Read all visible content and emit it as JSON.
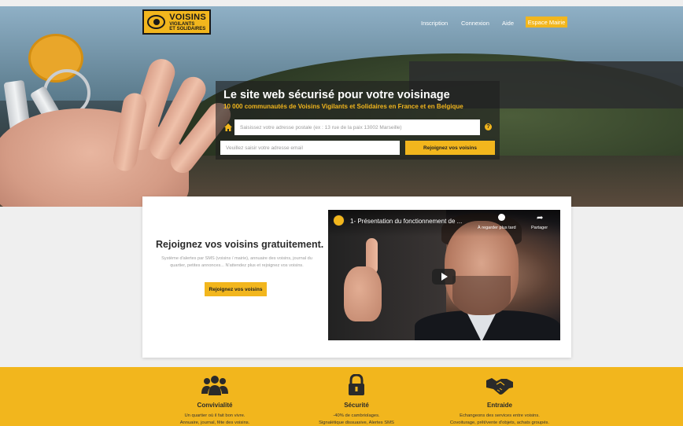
{
  "nav": {
    "logo_line1": "VOISINS",
    "logo_line2": "VIGILANTS",
    "logo_line3": "ET SOLIDAIRES",
    "inscription": "Inscription",
    "connexion": "Connexion",
    "aide": "Aide",
    "espace_mairie": "Espace Mairie"
  },
  "hero": {
    "title": "Le site web sécurisé pour votre voisinage",
    "subtitle": "10 000 communautés de Voisins Vigilants et Solidaires en France et en Belgique",
    "address_placeholder": "Saisissez votre adresse postale (ex : 13 rue de la paix 13002 Marseille)",
    "email_placeholder": "Veuillez saisir votre adresse email",
    "join_button": "Rejoignez vos voisins",
    "help_glyph": "?"
  },
  "card": {
    "title": "Rejoignez vos voisins gratuitement.",
    "description": "Système d'alertes par SMS (voisins / mairie), annuaire des voisins, journal du quartier, petites annonces... N'attendez plus et rejoignez vos voisins.",
    "button": "Rejoignez vos voisins"
  },
  "video": {
    "title": "1- Présentation du fonctionnement de ...",
    "watch_later": "À regarder plus tard",
    "share": "Partager"
  },
  "features": [
    {
      "icon": "users-icon",
      "title": "Convivialité",
      "line1": "Un quartier où il fait bon vivre.",
      "line2": "Annuaire, journal, fête des voisins."
    },
    {
      "icon": "lock-icon",
      "title": "Sécurité",
      "line1": "-40% de cambriolages.",
      "line2": "Signalétique dissuasive, Alertes SMS"
    },
    {
      "icon": "handshake-icon",
      "title": "Entraide",
      "line1": "Echangeons des services entre voisins.",
      "line2": "Covoiturage, prêt/vente d'objets, achats groupés."
    }
  ],
  "colors": {
    "accent": "#f2b61d",
    "dark": "#2b2b2b"
  }
}
